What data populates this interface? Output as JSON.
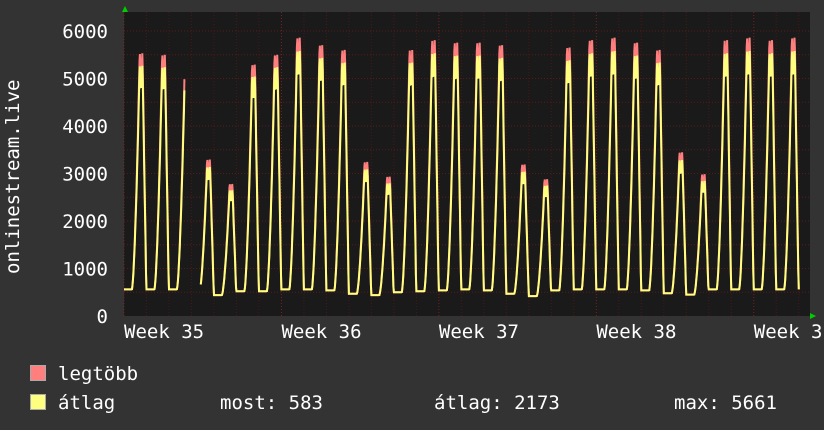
{
  "chart_data": {
    "type": "line",
    "ylabel": "onlinestream.live",
    "ylim": [
      0,
      6400
    ],
    "yticks": [
      0,
      1000,
      2000,
      3000,
      4000,
      5000,
      6000
    ],
    "x_tick_labels": [
      "Week 35",
      "Week 36",
      "Week 37",
      "Week 38",
      "Week 3"
    ],
    "x_tick_days": [
      0,
      7,
      14,
      21,
      28
    ],
    "x_range_days": [
      0,
      30.5
    ],
    "daily_peaks_avg": [
      5380,
      5350,
      5000,
      3200,
      2700,
      5150,
      5350,
      5700,
      5550,
      5450,
      3150,
      2850,
      5450,
      5650,
      5600,
      5600,
      5550,
      3100,
      2800,
      5500,
      5650,
      5700,
      5600,
      5450,
      3350,
      2900,
      5650,
      5700,
      5650,
      5700
    ],
    "daily_troughs_avg": [
      560,
      560,
      560,
      470,
      440,
      520,
      520,
      560,
      560,
      540,
      470,
      440,
      500,
      520,
      540,
      560,
      540,
      470,
      420,
      540,
      560,
      560,
      560,
      540,
      480,
      450,
      560,
      560,
      560,
      560
    ],
    "gap_days": [
      2.7,
      3.4
    ],
    "series": [
      {
        "name": "legtöbb",
        "color": "#ff7f7f",
        "values_note": ""
      },
      {
        "name": "átlag",
        "color": "#ffff7f",
        "values_note": ""
      }
    ],
    "stats": {
      "most_label": "most:",
      "most": "583",
      "atlag_label": "átlag:",
      "atlag": "2173",
      "max_label": "max:",
      "max": "5661"
    },
    "grid": true,
    "legend_position": "bottom-left"
  },
  "legend": {
    "max_label": "legtöbb",
    "avg_label": "átlag"
  },
  "colors": {
    "background": "#333333",
    "plot": "#1a1a1a",
    "grid": "#7a2020",
    "max": "#ff7f7f",
    "avg": "#ffff7f",
    "axis_arrow": "#00cc00"
  }
}
